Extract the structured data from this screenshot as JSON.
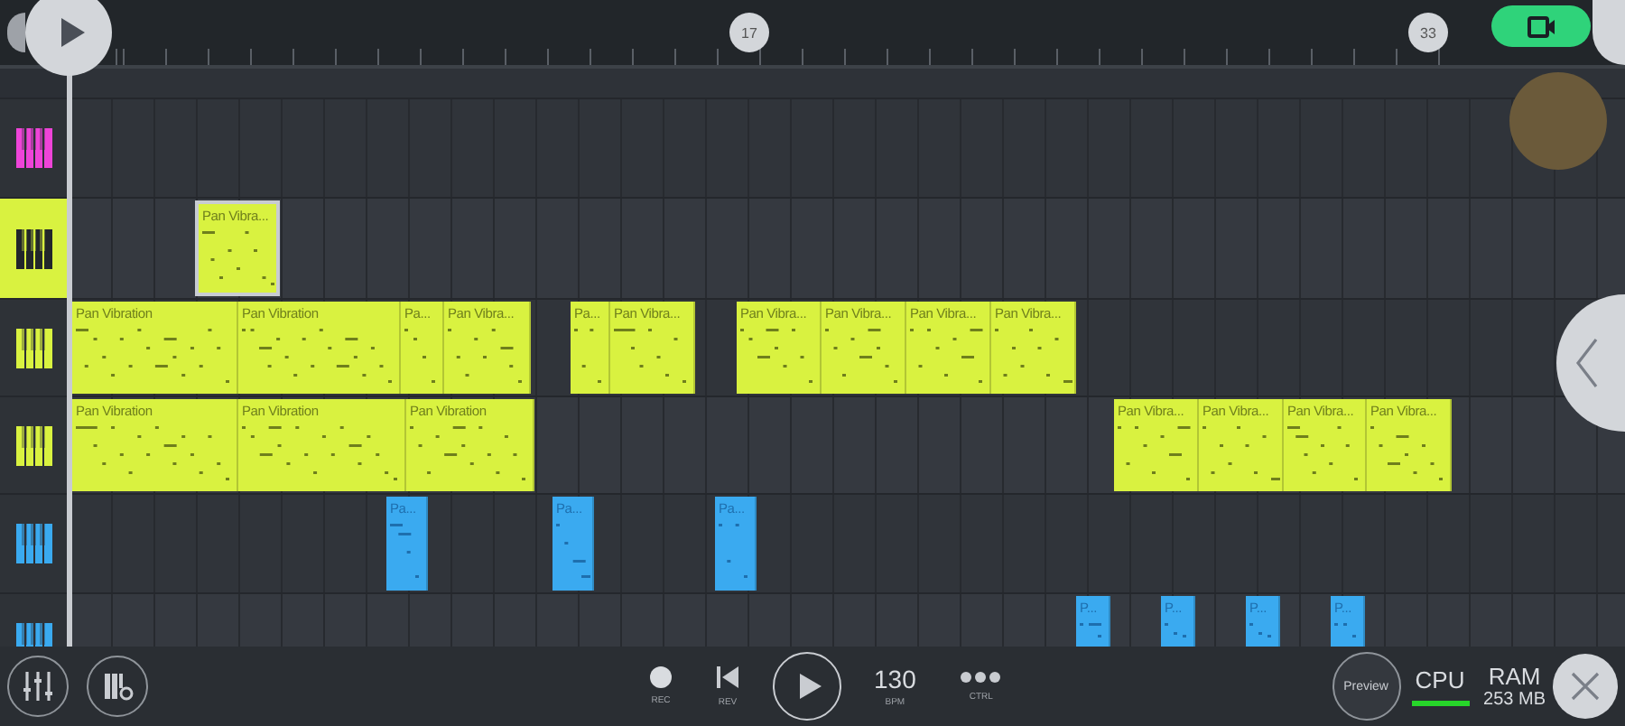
{
  "ruler": {
    "markers": [
      {
        "label": "17"
      },
      {
        "label": "33"
      }
    ]
  },
  "tracks": [
    {
      "color": "#ee44d8",
      "selected": false
    },
    {
      "color": "#d9f240",
      "selected": true,
      "clips": [
        {
          "label": "Pan Vibra..."
        }
      ]
    },
    {
      "color": "#d9f240",
      "selected": false,
      "clips": [
        {
          "label": "Pan Vibration"
        },
        {
          "label": "Pan Vibration"
        },
        {
          "label": "Pa..."
        },
        {
          "label": "Pan Vibra..."
        },
        {
          "label": "Pa..."
        },
        {
          "label": "Pan Vibra..."
        },
        {
          "label": "Pan Vibra..."
        },
        {
          "label": "Pan Vibra..."
        },
        {
          "label": "Pan Vibra..."
        },
        {
          "label": "Pan Vibra..."
        }
      ]
    },
    {
      "color": "#d9f240",
      "selected": false,
      "clips": [
        {
          "label": "Pan Vibration"
        },
        {
          "label": "Pan Vibration"
        },
        {
          "label": "Pan Vibration"
        },
        {
          "label": "Pan Vibra..."
        },
        {
          "label": "Pan Vibra..."
        },
        {
          "label": "Pan Vibra..."
        },
        {
          "label": "Pan Vibra..."
        }
      ]
    },
    {
      "color": "#3aaaf0",
      "selected": false,
      "clips": [
        {
          "label": "Pa..."
        },
        {
          "label": "Pa..."
        },
        {
          "label": "Pa..."
        }
      ]
    },
    {
      "color": "#3aaaf0",
      "selected": false,
      "clips": [
        {
          "label": "P..."
        },
        {
          "label": "P..."
        },
        {
          "label": "P..."
        },
        {
          "label": "P..."
        }
      ]
    }
  ],
  "transport": {
    "rec_label": "REC",
    "rev_label": "REV",
    "tempo": "130",
    "tempo_label": "BPM",
    "ctrl_label": "CTRL"
  },
  "preview": "Preview",
  "cpu": {
    "label": "CPU",
    "level": 1
  },
  "ram": {
    "label": "RAM",
    "value": "253 MB"
  }
}
